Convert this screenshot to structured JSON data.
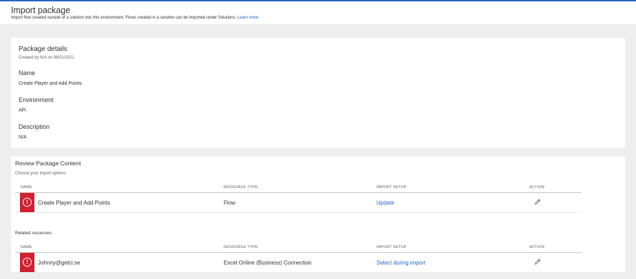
{
  "header": {
    "title": "Import package",
    "subtitle": "Import flow created outside of a solution into this environment. Flows created in a solution can be imported under Solutions.",
    "learn_more": "Learn more"
  },
  "details": {
    "title": "Package details",
    "created": "Created by N/A on 06/01/2021",
    "fields": [
      {
        "label": "Name",
        "value": "Create Player and Add Points"
      },
      {
        "label": "Environment",
        "value": "APi"
      },
      {
        "label": "Description",
        "value": "N/A"
      }
    ]
  },
  "review": {
    "title": "Review Package Content",
    "subtitle": "Choose your import options.",
    "columns": [
      "NAME",
      "RESOURCE TYPE",
      "IMPORT SETUP",
      "ACTION"
    ],
    "rows": [
      {
        "name": "Create Player and Add Points",
        "type": "Flow",
        "setup": "Update",
        "status_icon": "error-icon",
        "action_icon": "edit-icon"
      }
    ],
    "related_title": "Related resources",
    "related_rows": [
      {
        "name": "Johnny@getci.se",
        "type": "Excel Online (Business) Connection",
        "setup": "Select during import",
        "status_icon": "error-icon",
        "action_icon": "edit-icon"
      }
    ]
  },
  "colors": {
    "accent": "#2266c7",
    "error": "#d1202f",
    "background": "#eeeeee"
  }
}
